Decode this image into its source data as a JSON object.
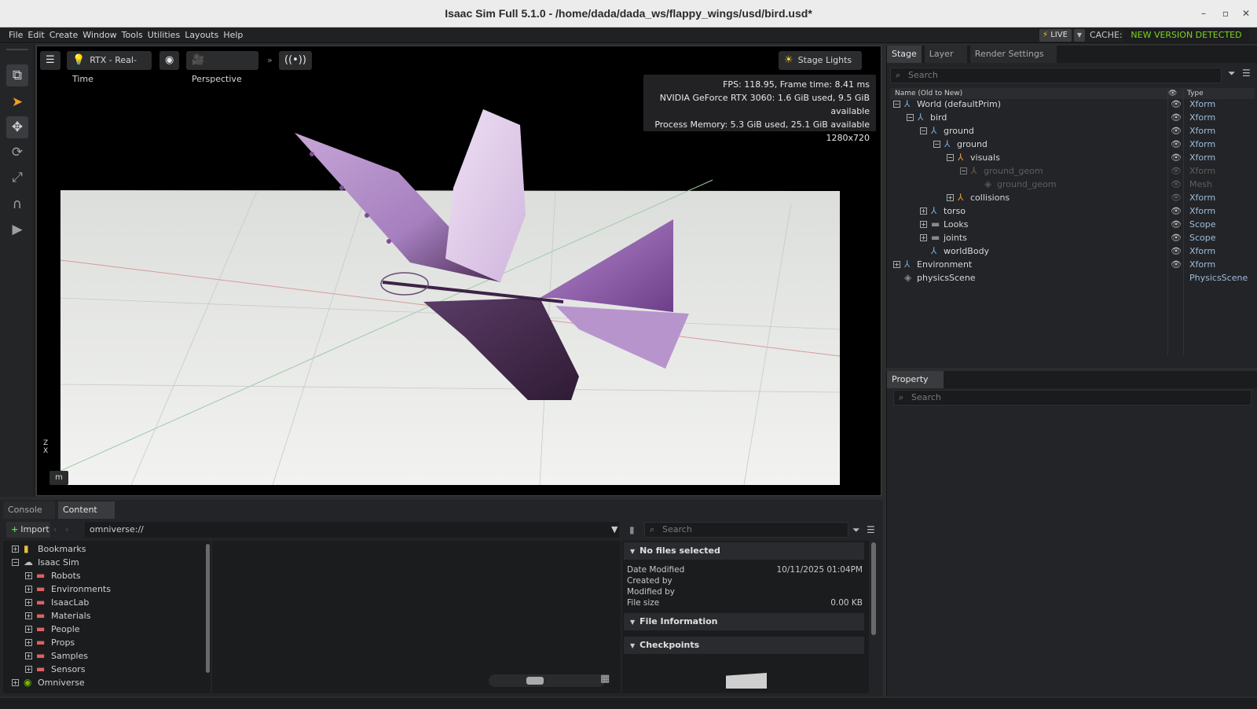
{
  "window": {
    "title": "Isaac Sim Full 5.1.0 - /home/dada/dada_ws/flappy_wings/usd/bird.usd*"
  },
  "menu": [
    "File",
    "Edit",
    "Create",
    "Window",
    "Tools",
    "Utilities",
    "Layouts",
    "Help"
  ],
  "topright": {
    "live": "LIVE",
    "cache": "CACHE:",
    "new_version": "NEW VERSION DETECTED"
  },
  "viewport": {
    "renderer": "RTX - Real-Time",
    "camera": "Perspective",
    "stage_lights": "Stage Lights",
    "stats": {
      "fps": "FPS: 118.95, Frame time: 8.41 ms",
      "gpu": "NVIDIA GeForce RTX 3060: 1.6 GiB used, 9.5 GiB available",
      "memory": "Process Memory: 5.3 GiB used, 25.1 GiB available",
      "resolution": "1280x720"
    },
    "unit": "m",
    "axes": "Z\nX"
  },
  "stage": {
    "tabs": [
      "Stage",
      "Layer",
      "Render Settings"
    ],
    "search_placeholder": "Search",
    "col_name": "Name (Old to New)",
    "col_type": "Type",
    "items": [
      {
        "name": "World (defaultPrim)",
        "type": "Xform"
      },
      {
        "name": "bird",
        "type": "Xform"
      },
      {
        "name": "ground",
        "type": "Xform"
      },
      {
        "name": "ground",
        "type": "Xform"
      },
      {
        "name": "visuals",
        "type": "Xform"
      },
      {
        "name": "ground_geom",
        "type": "Xform"
      },
      {
        "name": "ground_geom",
        "type": "Mesh"
      },
      {
        "name": "collisions",
        "type": "Xform"
      },
      {
        "name": "torso",
        "type": "Xform"
      },
      {
        "name": "Looks",
        "type": "Scope"
      },
      {
        "name": "joints",
        "type": "Scope"
      },
      {
        "name": "worldBody",
        "type": "Xform"
      },
      {
        "name": "Environment",
        "type": "Xform"
      },
      {
        "name": "physicsScene",
        "type": "PhysicsScene"
      }
    ]
  },
  "property": {
    "tab": "Property",
    "search_placeholder": "Search"
  },
  "bottom": {
    "tabs": [
      "Console",
      "Content"
    ],
    "import": "Import",
    "path": "omniverse://",
    "search_placeholder": "Search",
    "tree": [
      {
        "name": "Bookmarks"
      },
      {
        "name": "Isaac Sim"
      },
      {
        "name": "Robots"
      },
      {
        "name": "Environments"
      },
      {
        "name": "IsaacLab"
      },
      {
        "name": "Materials"
      },
      {
        "name": "People"
      },
      {
        "name": "Props"
      },
      {
        "name": "Samples"
      },
      {
        "name": "Sensors"
      },
      {
        "name": "Omniverse"
      }
    ],
    "info": {
      "title": "No files selected",
      "date_modified_label": "Date Modified",
      "date_modified": "10/11/2025 01:04PM",
      "created_by_label": "Created by",
      "modified_by_label": "Modified by",
      "file_size_label": "File size",
      "file_size": "0.00 KB",
      "file_information": "File Information",
      "checkpoints": "Checkpoints"
    }
  }
}
